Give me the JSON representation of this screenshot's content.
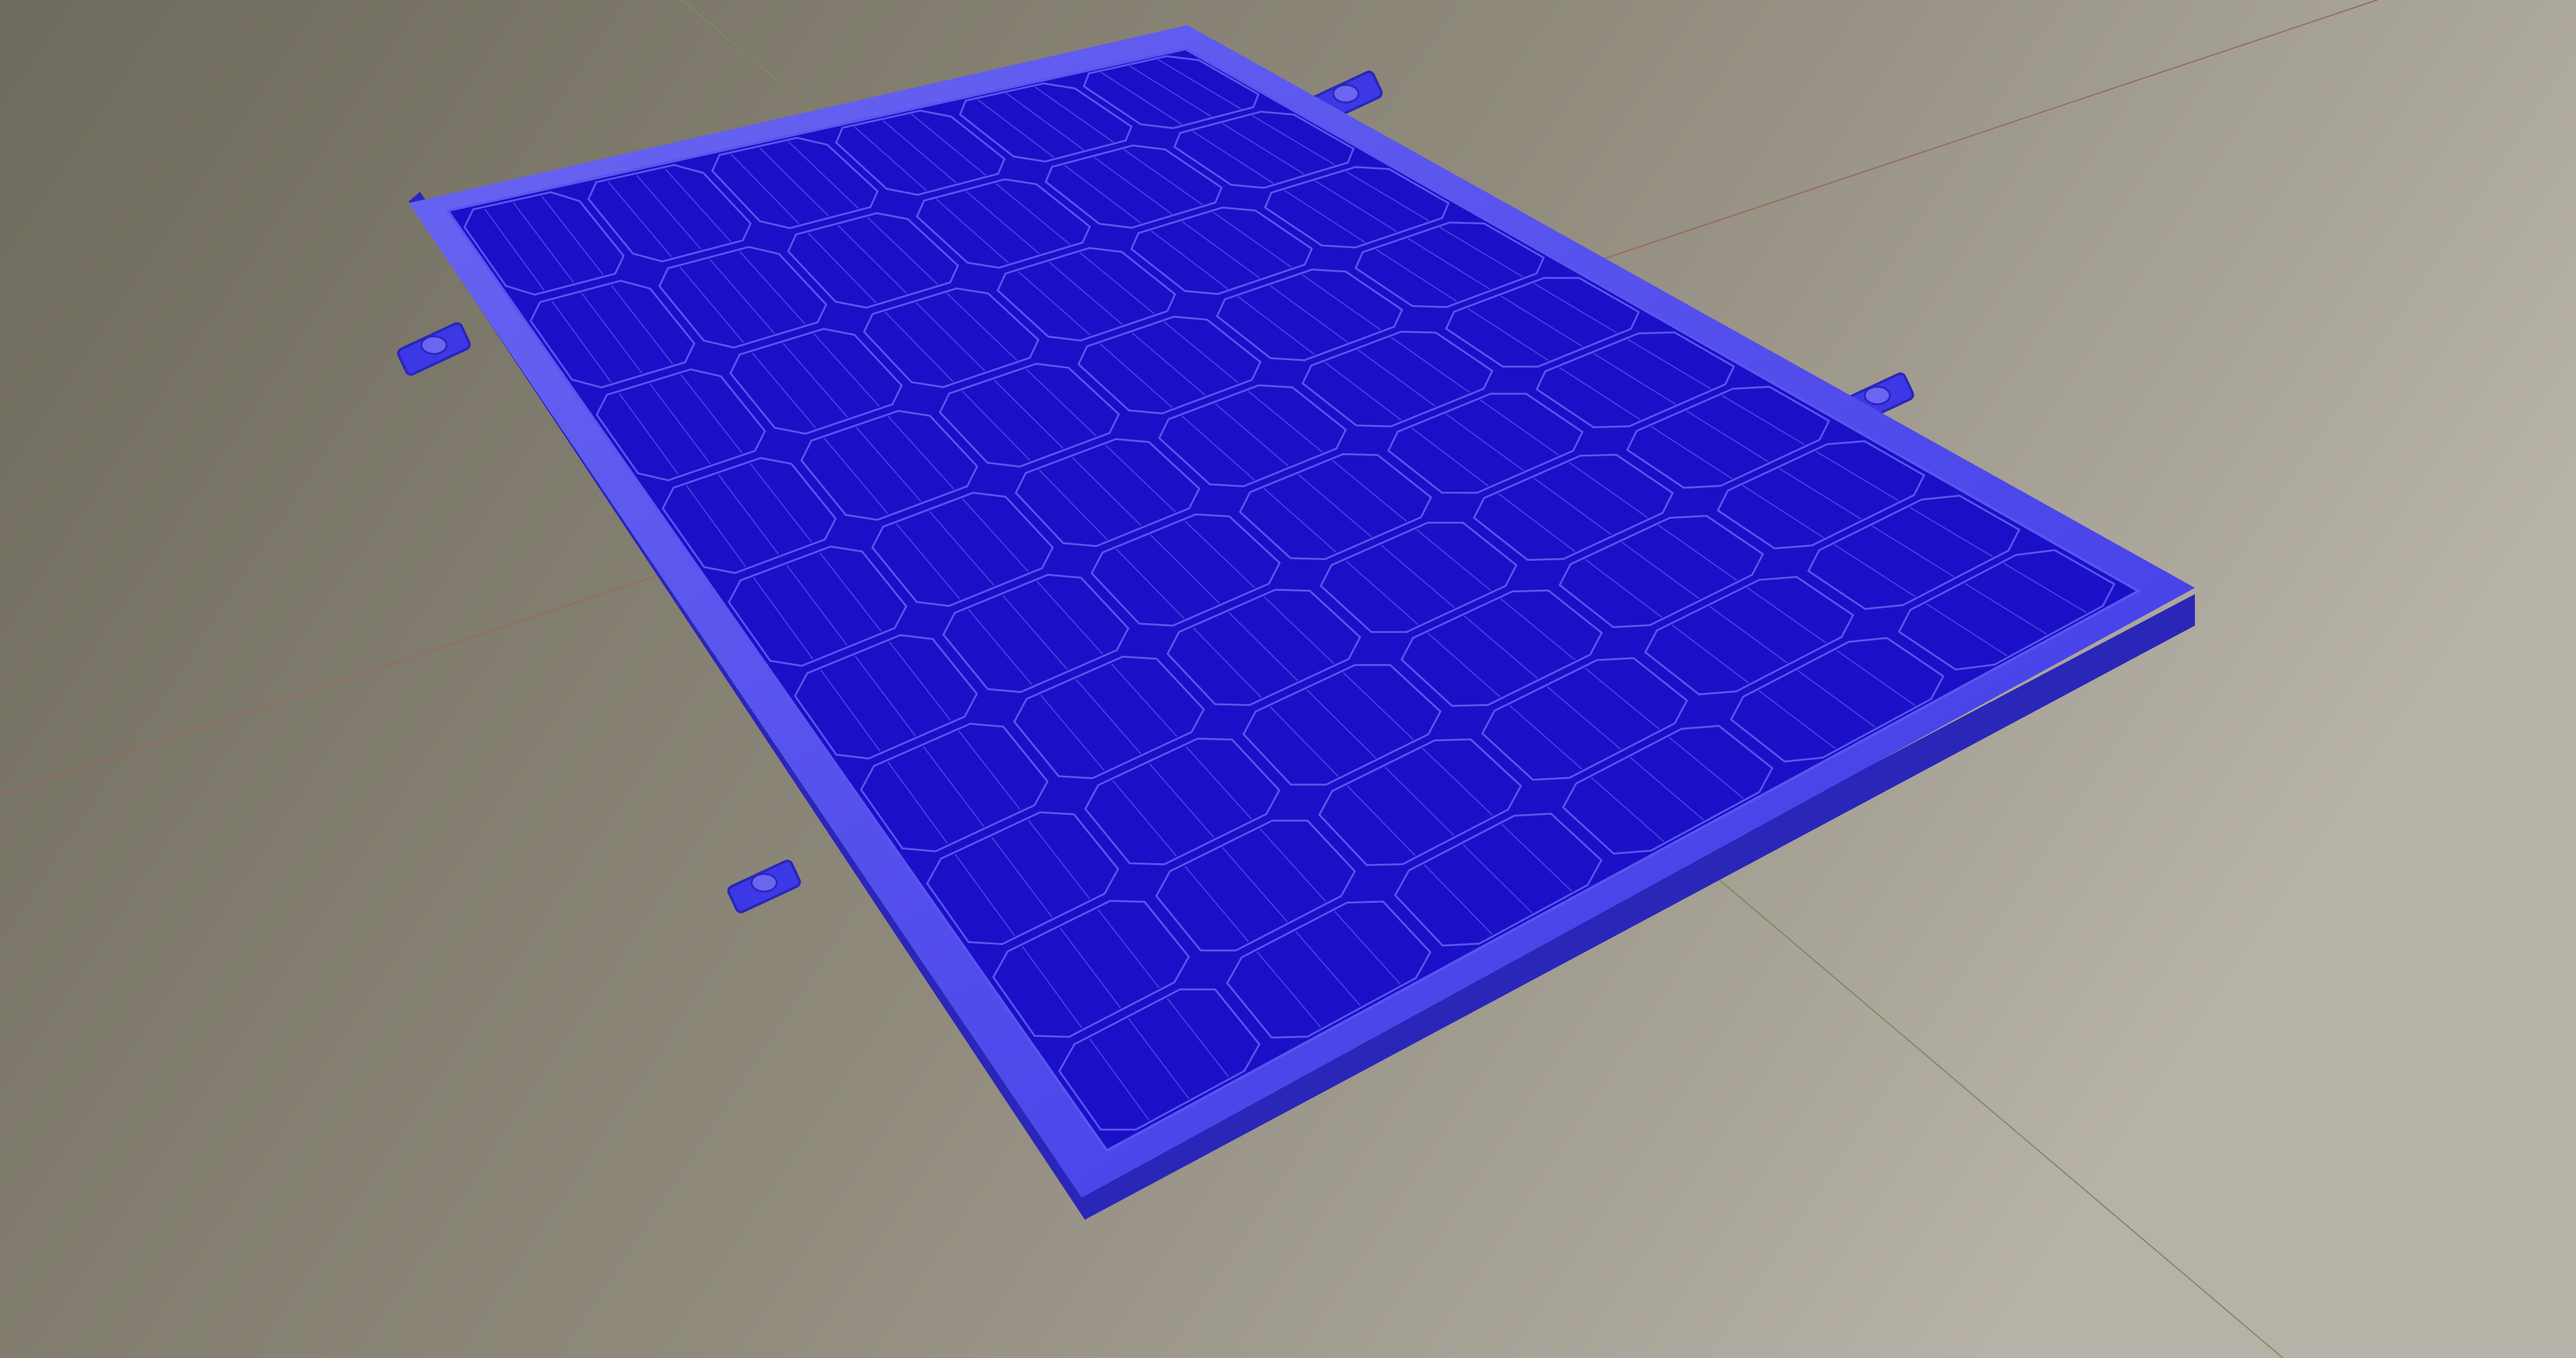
{
  "scene": {
    "subject": "solar-panel",
    "cell_rows": 10,
    "cell_columns": 6,
    "clamp_count": 4,
    "grid_axes_visible": true
  },
  "colors": {
    "background_dark": "#6e6a5d",
    "background_mid": "#8f8a7c",
    "background_light": "#b7b2a8",
    "panel_frame": "#3d38e6",
    "panel_frame_shadow": "#2a26b8",
    "panel_frame_highlight": "#6a66f2",
    "cell_fill": "#1a10c8",
    "cell_line": "#5a55ee",
    "axis_x": "#9a6a5e",
    "axis_y": "#7e8a5e"
  }
}
